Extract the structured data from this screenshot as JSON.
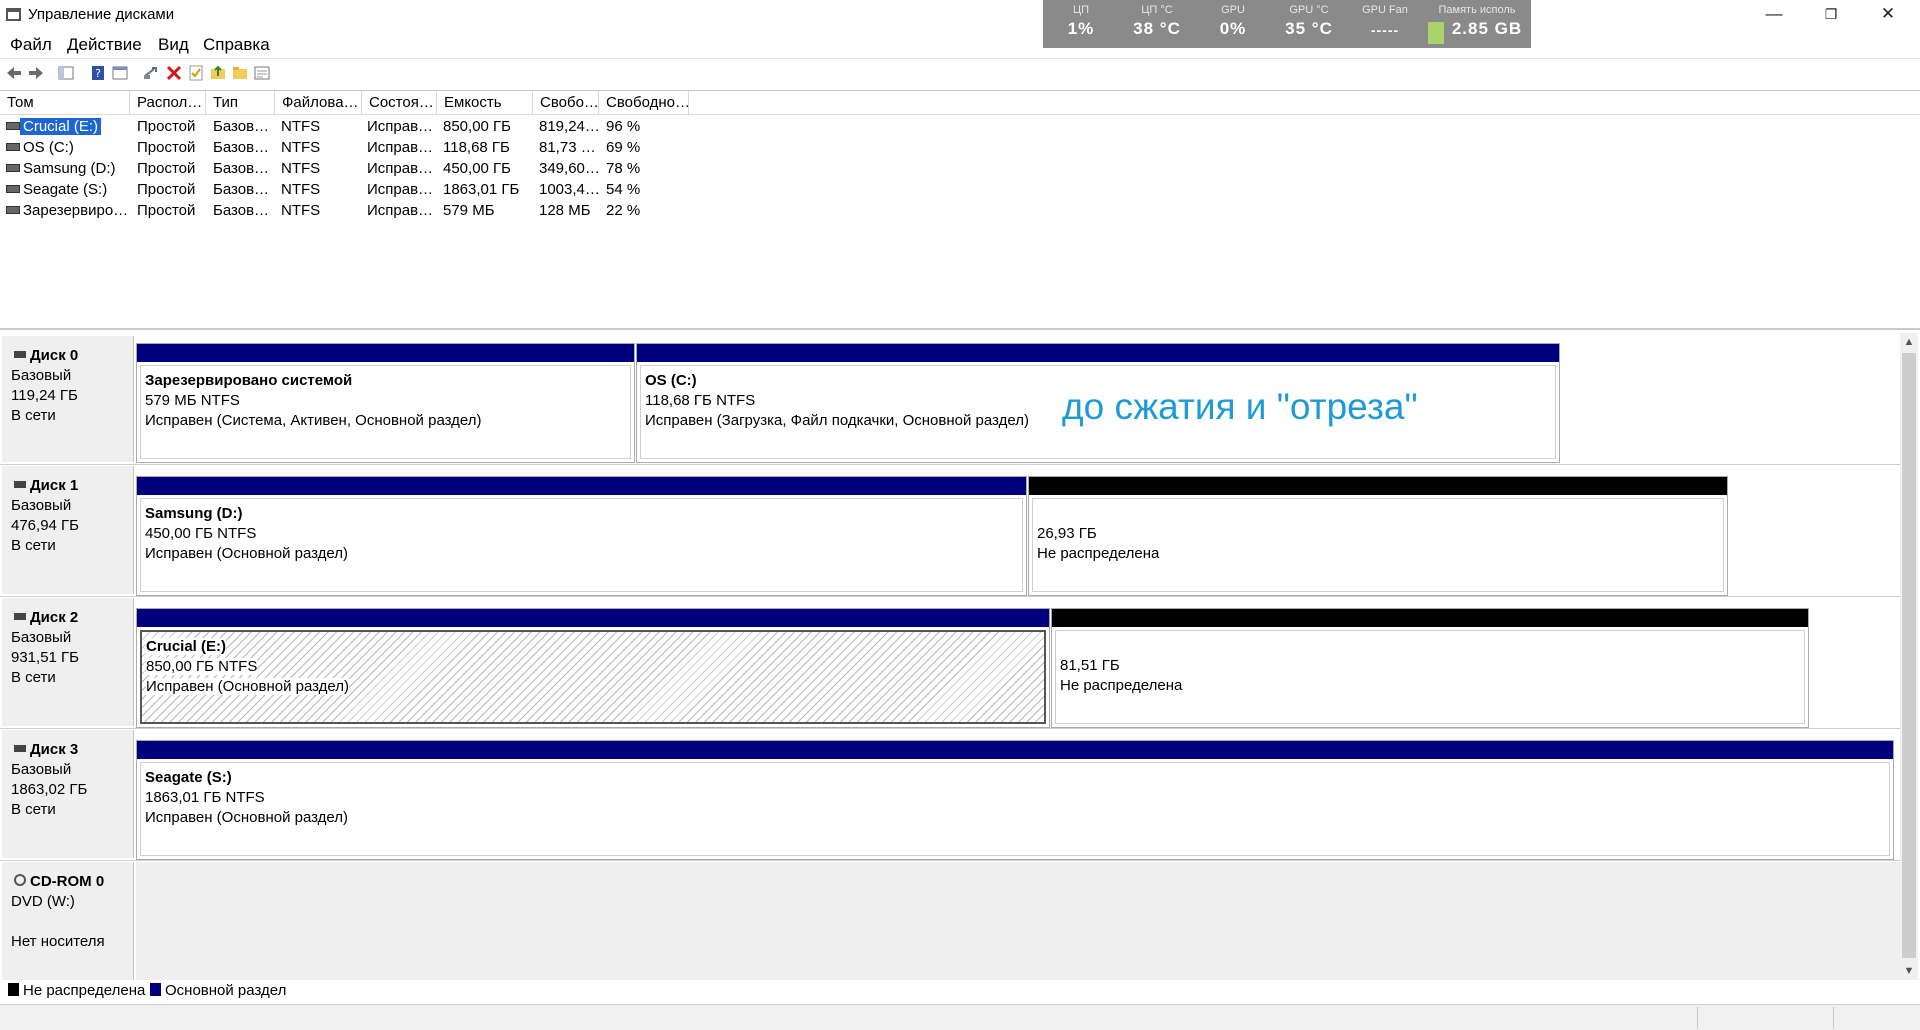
{
  "window": {
    "title": "Управление дисками",
    "minimize": "—",
    "maximize": "❐",
    "close": "✕"
  },
  "monitor": {
    "cells": [
      {
        "label": "ЦП",
        "value": "1%"
      },
      {
        "label": "ЦП °C",
        "value": "38 °C"
      },
      {
        "label": "GPU",
        "value": "0%"
      },
      {
        "label": "GPU °C",
        "value": "35 °C"
      },
      {
        "label": "GPU Fan",
        "value": "-----"
      },
      {
        "label": "Память исполь",
        "value": "2.85 GB"
      }
    ]
  },
  "menu": [
    "Файл",
    "Действие",
    "Вид",
    "Справка"
  ],
  "toolbar": [
    "back-icon",
    "forward-icon",
    "console-tree-icon",
    "help-icon",
    "properties-icon",
    "connect-icon",
    "delete-icon",
    "check-icon",
    "folder-up-icon",
    "folder-open-icon",
    "view-icon"
  ],
  "columns": [
    "Том",
    "Распол…",
    "Тип",
    "Файлова…",
    "Состоя…",
    "Емкость",
    "Свобо…",
    "Свободно…"
  ],
  "volumes": [
    [
      "Crucial (E:)",
      "Простой",
      "Базов…",
      "NTFS",
      "Исправ…",
      "850,00 ГБ",
      "819,24…",
      "96 %"
    ],
    [
      "OS (C:)",
      "Простой",
      "Базов…",
      "NTFS",
      "Исправ…",
      "118,68 ГБ",
      "81,73 …",
      "69 %"
    ],
    [
      "Samsung (D:)",
      "Простой",
      "Базов…",
      "NTFS",
      "Исправ…",
      "450,00 ГБ",
      "349,60…",
      "78 %"
    ],
    [
      "Seagate (S:)",
      "Простой",
      "Базов…",
      "NTFS",
      "Исправ…",
      "1863,01 ГБ",
      "1003,4…",
      "54 %"
    ],
    [
      "Зарезервиро…",
      "Простой",
      "Базов…",
      "NTFS",
      "Исправ…",
      "579 МБ",
      "128 МБ",
      "22 %"
    ]
  ],
  "disks": [
    {
      "name": "Диск 0",
      "type": "Базовый",
      "size": "119,24 ГБ",
      "status": "В сети",
      "partitions": [
        {
          "name": "Зарезервировано системой",
          "size": "579 МБ NTFS",
          "status": "Исправен (Система, Активен, Основной раздел)"
        },
        {
          "name": "OS  (C:)",
          "size": "118,68 ГБ NTFS",
          "status": "Исправен (Загрузка, Файл подкачки, Основной раздел)"
        }
      ]
    },
    {
      "name": "Диск 1",
      "type": "Базовый",
      "size": "476,94 ГБ",
      "status": "В сети",
      "partitions": [
        {
          "name": "Samsung  (D:)",
          "size": "450,00 ГБ NTFS",
          "status": "Исправен (Основной раздел)"
        },
        {
          "name": "",
          "size": "26,93 ГБ",
          "status": "Не распределена"
        }
      ]
    },
    {
      "name": "Диск 2",
      "type": "Базовый",
      "size": "931,51 ГБ",
      "status": "В сети",
      "partitions": [
        {
          "name": "Crucial  (E:)",
          "size": "850,00 ГБ NTFS",
          "status": "Исправен (Основной раздел)"
        },
        {
          "name": "",
          "size": "81,51 ГБ",
          "status": "Не распределена"
        }
      ]
    },
    {
      "name": "Диск 3",
      "type": "Базовый",
      "size": "1863,02 ГБ",
      "status": "В сети",
      "partitions": [
        {
          "name": "Seagate  (S:)",
          "size": "1863,01 ГБ NTFS",
          "status": "Исправен (Основной раздел)"
        }
      ]
    },
    {
      "name": "CD-ROM 0",
      "type": "DVD (W:)",
      "size": "",
      "status": "Нет носителя",
      "partitions": []
    }
  ],
  "annotation": "до сжатия и \"отреза\"",
  "legend": {
    "unallocated": "Не распределена",
    "primary": "Основной раздел"
  },
  "colors": {
    "primary": "#00007f",
    "unallocated": "#000000",
    "selection": "#1e66d1",
    "annotation": "#1e9bd7"
  }
}
